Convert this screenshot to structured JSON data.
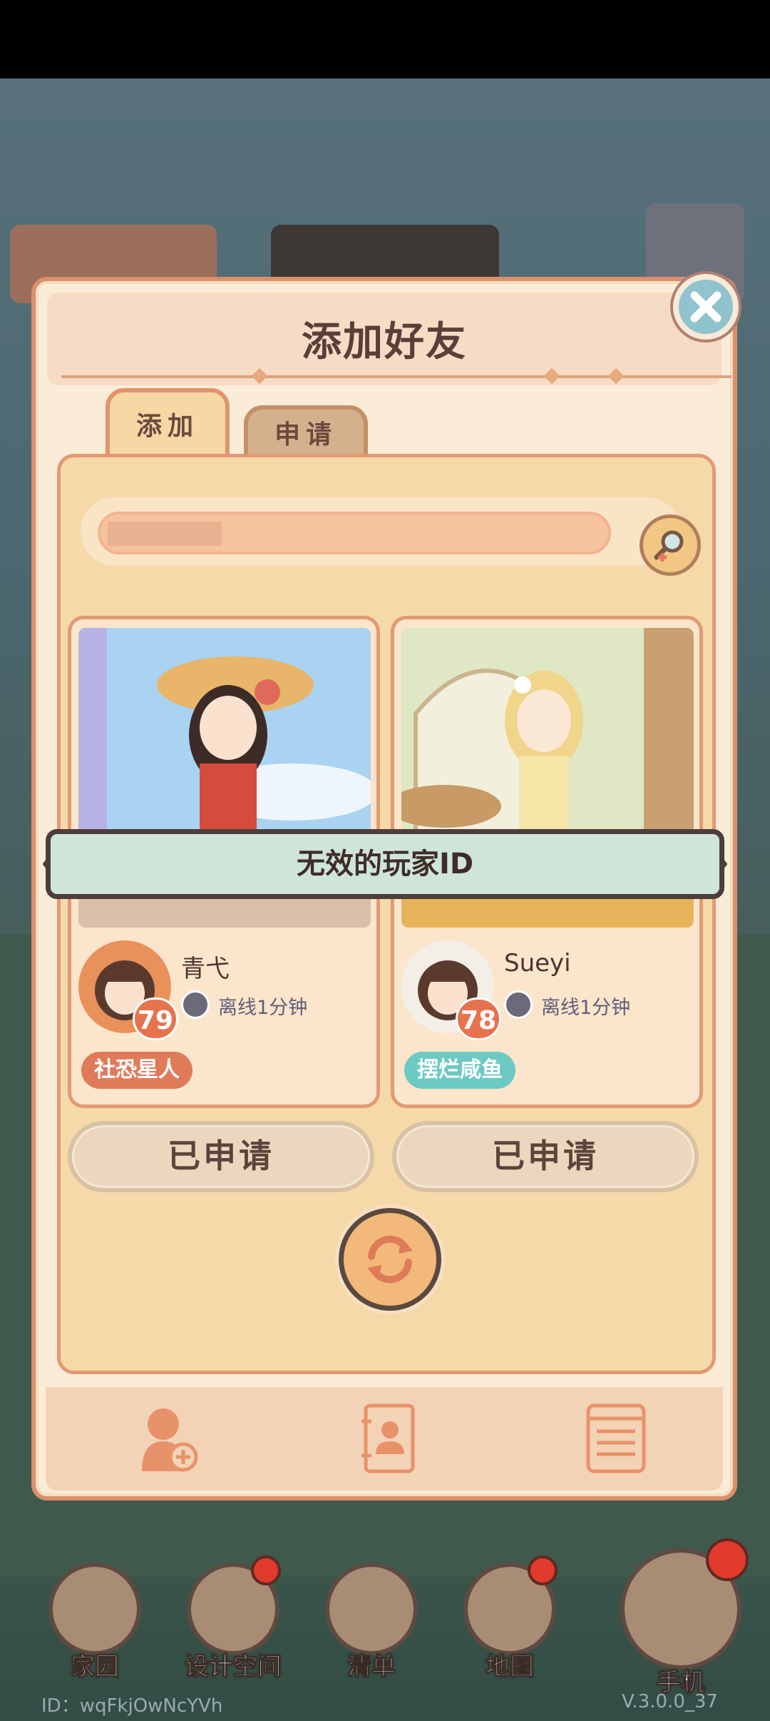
{
  "dialog": {
    "title": "添加好友",
    "tabs": [
      {
        "label": "添加"
      },
      {
        "label": "申请"
      }
    ],
    "refresh_icon": "refresh-icon",
    "nav_icons": [
      "add-friend-icon",
      "contacts-book-icon",
      "list-icon"
    ]
  },
  "players": [
    {
      "name": "青弋",
      "level": "79",
      "status": "离线1分钟",
      "tag": "社恐星人",
      "button": "已申请"
    },
    {
      "name": "Sueyi",
      "level": "78",
      "status": "离线1分钟",
      "tag": "摆烂咸鱼",
      "button": "已申请"
    }
  ],
  "toast": {
    "message": "无效的玩家ID"
  },
  "main_nav": [
    {
      "label": "家园"
    },
    {
      "label": "设计空间"
    },
    {
      "label": "清单"
    },
    {
      "label": "地图"
    },
    {
      "label": "手机"
    }
  ],
  "footer": {
    "player_id": "ID：wqFkjOwNcYVh",
    "version": "V.3.0.0_37"
  },
  "colors": {
    "accent": "#e29a74",
    "panel": "#f6d9a9",
    "toast": "#cfe5da",
    "tag1": "#e07b5a",
    "tag2": "#6ccac3"
  }
}
